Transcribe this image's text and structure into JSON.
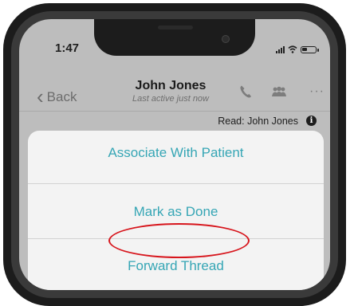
{
  "status_bar": {
    "time": "1:47"
  },
  "nav": {
    "back_label": "Back",
    "contact_name": "John Jones",
    "contact_subtitle": "Last active just now",
    "icons": [
      "phone-icon",
      "people-icon",
      "more-icon"
    ]
  },
  "read_receipt": "Read: John Jones",
  "info_icon_glyph": "i",
  "more_glyph": "···",
  "back_chevron": "‹",
  "action_sheet": {
    "items": [
      {
        "label": "Associate With Patient"
      },
      {
        "label": "Mark as Done"
      },
      {
        "label": "Forward Thread"
      }
    ]
  },
  "colors": {
    "accent": "#36a6b5",
    "highlight": "#d7151c"
  }
}
